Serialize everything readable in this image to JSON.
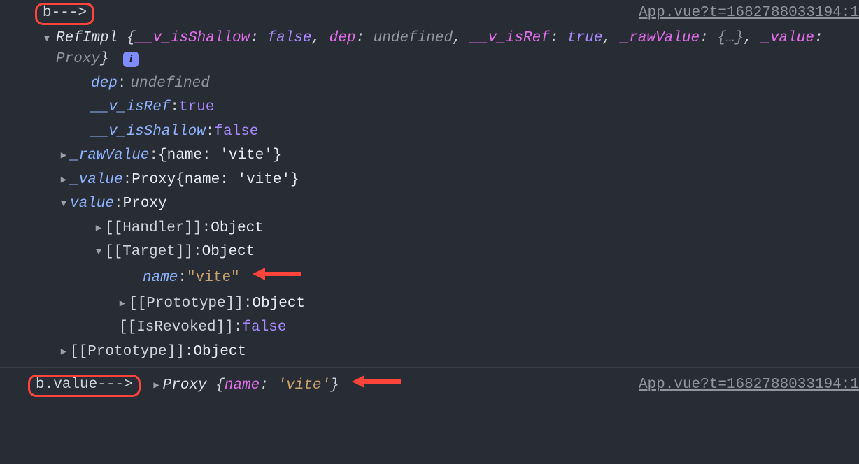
{
  "log1": {
    "prefix": "b--->",
    "source": "App.vue?t=1682788033194:1",
    "class_name": "RefImpl",
    "summary_parts": {
      "k1": "__v_isShallow",
      "v1": "false",
      "k2": "dep",
      "v2": "undefined",
      "k3": "__v_isRef",
      "v3": "true",
      "k4": "_rawValue",
      "v4": "{…}",
      "k5": "_value",
      "v5": "Proxy"
    },
    "info_badge": "i",
    "props": {
      "dep": {
        "label": "dep",
        "value": "undefined"
      },
      "v_isRef": {
        "label": "__v_isRef",
        "value": "true"
      },
      "v_isShallow": {
        "label": "__v_isShallow",
        "value": "false"
      },
      "rawValue": {
        "label": "_rawValue",
        "value": "{name: 'vite'}"
      },
      "value": {
        "label": "_value",
        "pre": "Proxy ",
        "value": "{name: 'vite'}"
      },
      "valueAcc": {
        "label": "value",
        "value": "Proxy"
      },
      "handler": {
        "label": "[[Handler]]",
        "value": "Object"
      },
      "target": {
        "label": "[[Target]]",
        "value": "Object"
      },
      "target_name": {
        "label": "name",
        "value": "\"vite\""
      },
      "target_proto": {
        "label": "[[Prototype]]",
        "value": "Object"
      },
      "isRevoked": {
        "label": "[[IsRevoked]]",
        "value": "false"
      },
      "proto": {
        "label": "[[Prototype]]",
        "value": "Object"
      }
    }
  },
  "log2": {
    "prefix": "b.value--->",
    "source": "App.vue?t=1682788033194:1",
    "proxy_label": "Proxy",
    "key": "name",
    "val": "'vite'"
  }
}
